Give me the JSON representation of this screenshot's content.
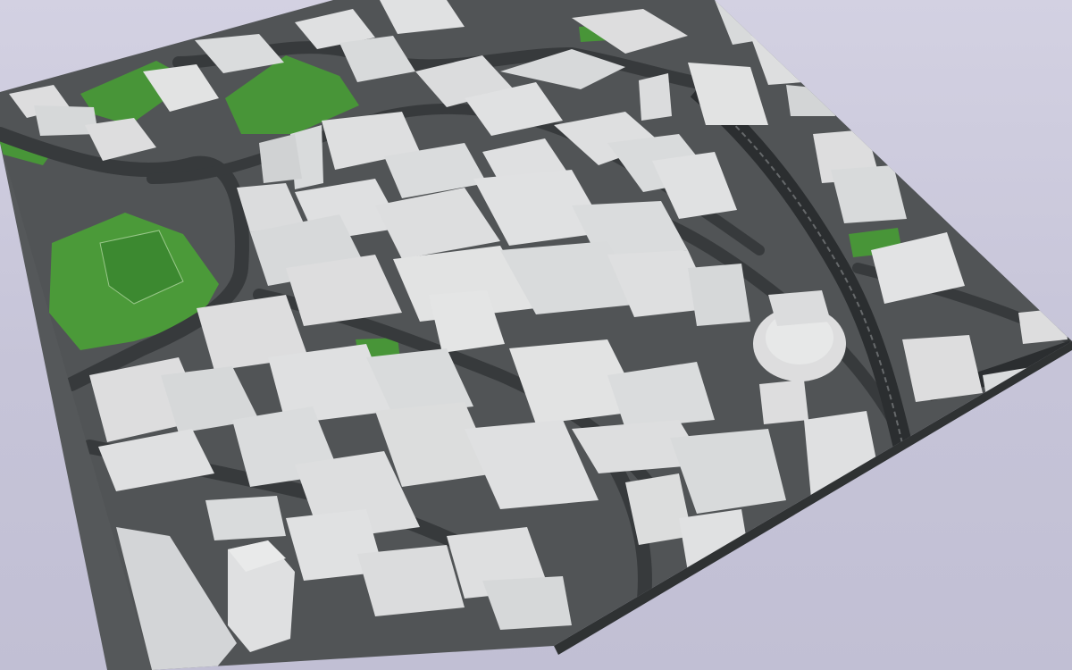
{
  "scene": {
    "view": "3d-city-model",
    "colors": {
      "background": "#c9c7d9",
      "ground": "#56595a",
      "road": "#3b3e40",
      "building": "#e7e8e9",
      "building_shade": "#c3c5c7",
      "grass": "#4a9a3a",
      "railway": "#2f3234"
    }
  }
}
